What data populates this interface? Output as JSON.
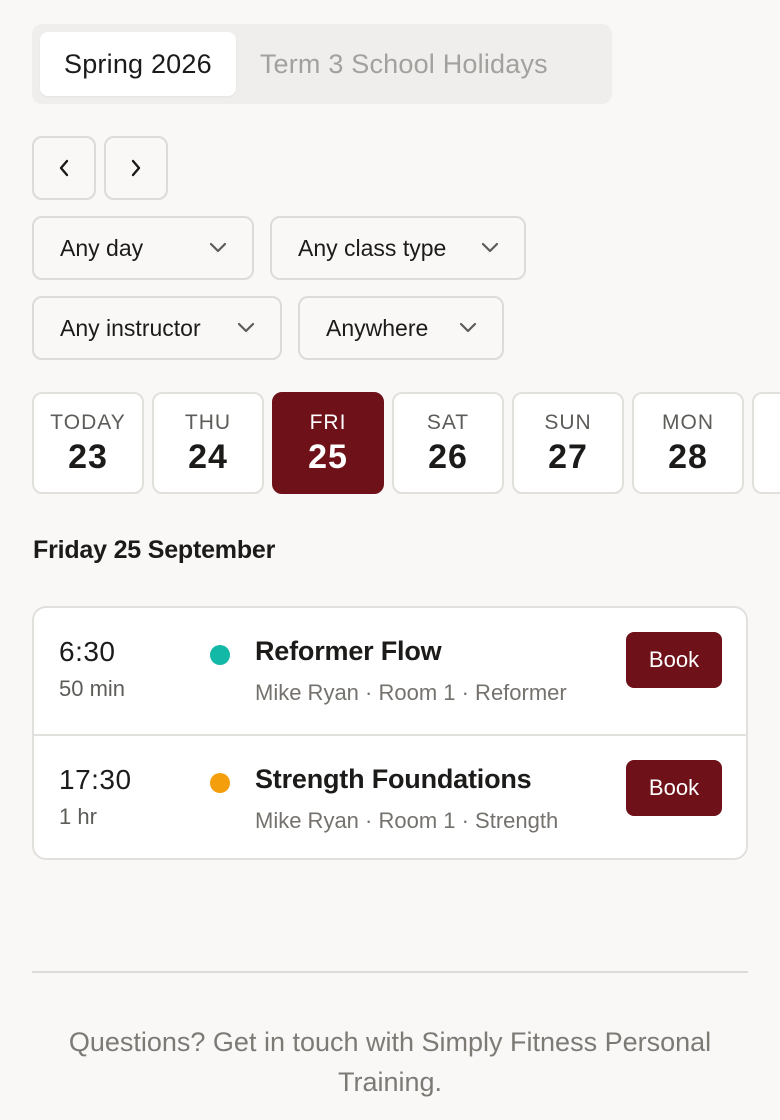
{
  "term_tabs": [
    "Spring 2026",
    "Term 3 School Holidays"
  ],
  "nav": {
    "prev_icon": "chevron-left-icon",
    "next_icon": "chevron-right-icon"
  },
  "filters": {
    "day": "Any day",
    "class_type": "Any class type",
    "instructor": "Any instructor",
    "location": "Anywhere"
  },
  "days": [
    {
      "name": "TODAY",
      "num": "23"
    },
    {
      "name": "THU",
      "num": "24"
    },
    {
      "name": "FRI",
      "num": "25"
    },
    {
      "name": "SAT",
      "num": "26"
    },
    {
      "name": "SUN",
      "num": "27"
    },
    {
      "name": "MON",
      "num": "28"
    }
  ],
  "heading": "Friday 25 September",
  "sessions": [
    {
      "time": "6:30",
      "duration": "50 min",
      "name": "Reformer Flow",
      "meta": "Mike Ryan · Room 1 · Reformer",
      "dot_color": "#14b8a6",
      "book": "Book"
    },
    {
      "time": "17:30",
      "duration": "1 hr",
      "name": "Strength Foundations",
      "meta": "Mike Ryan · Room 1 · Strength",
      "dot_color": "#f59e0b",
      "book": "Book"
    }
  ],
  "colors": {
    "accent": "#6e1119"
  },
  "footer": {
    "text": "Questions? Get in touch with Simply Fitness Personal Training."
  }
}
